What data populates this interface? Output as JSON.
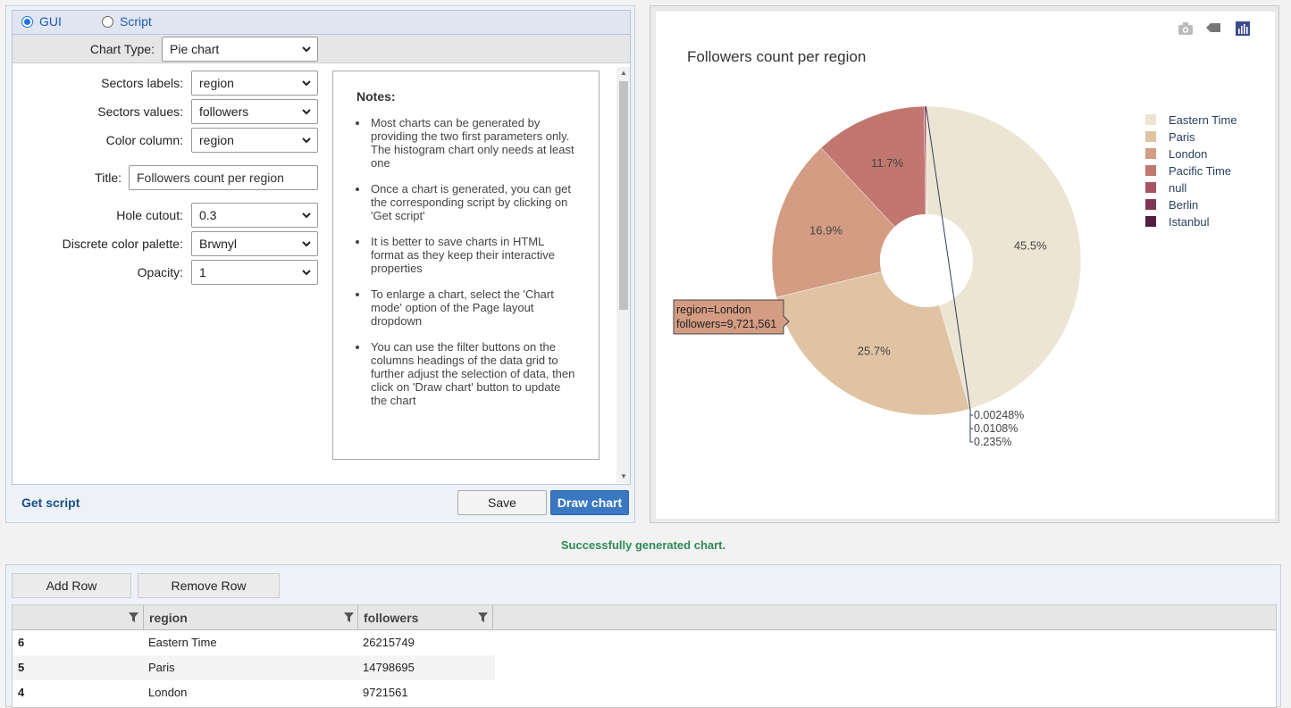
{
  "mode": {
    "options": [
      {
        "label": "GUI",
        "checked": true
      },
      {
        "label": "Script",
        "checked": false
      }
    ]
  },
  "form": {
    "chart_type": {
      "label": "Chart Type:",
      "value": "Pie chart"
    },
    "sectors_labels": {
      "label": "Sectors labels:",
      "value": "region"
    },
    "sectors_values": {
      "label": "Sectors values:",
      "value": "followers"
    },
    "color_column": {
      "label": "Color column:",
      "value": "region"
    },
    "title": {
      "label": "Title:",
      "value": "Followers count per region"
    },
    "hole_cutout": {
      "label": "Hole cutout:",
      "value": "0.3"
    },
    "palette": {
      "label": "Discrete color palette:",
      "value": "Brwnyl"
    },
    "opacity": {
      "label": "Opacity:",
      "value": "1"
    }
  },
  "notes": {
    "title": "Notes:",
    "items": [
      "Most charts can be generated by providing the two first parameters only. The histogram chart only needs at least one",
      "Once a chart is generated, you can get the corresponding script by clicking on 'Get script'",
      "It is better to save charts in HTML format as they keep their interactive properties",
      "To enlarge a chart, select the 'Chart mode' option of the Page layout dropdown",
      "You can use the filter buttons on the columns headings of the data grid to further adjust the selection of data, then click on 'Draw chart' button to update the chart"
    ]
  },
  "actions": {
    "get_script": "Get script",
    "save": "Save",
    "draw_chart": "Draw chart"
  },
  "toolbar_icons": [
    "camera-icon",
    "tag-icon",
    "plotly-logo-icon"
  ],
  "chart_data": {
    "type": "pie",
    "title": "Followers count per region",
    "hole": 0.3,
    "slices": [
      {
        "label": "Eastern Time",
        "value": 26215749,
        "percent_text": "45.5%",
        "color": "#ede5d3"
      },
      {
        "label": "Paris",
        "value": 14798695,
        "percent_text": "25.7%",
        "color": "#e0c3a3"
      },
      {
        "label": "London",
        "value": 9721561,
        "percent_text": "16.9%",
        "color": "#d39c83"
      },
      {
        "label": "Pacific Time",
        "value": 6740000,
        "percent_text": "11.7%",
        "color": "#c1766f"
      },
      {
        "label": "null",
        "value": 135400,
        "percent_text": "0.235%",
        "color": "#a65461"
      },
      {
        "label": "Berlin",
        "value": 6220,
        "percent_text": "0.0108%",
        "color": "#813753"
      },
      {
        "label": "Istanbul",
        "value": 1430,
        "percent_text": "0.00248%",
        "color": "#541f3f"
      }
    ],
    "small_labels_order": [
      "0.00248%",
      "0.0108%",
      "0.235%"
    ],
    "legend_position": "right",
    "tooltip": {
      "line1": "region=London",
      "line2": "followers=9,721,561"
    }
  },
  "status": "Successfully generated chart.",
  "grid": {
    "buttons": {
      "add": "Add Row",
      "remove": "Remove Row"
    },
    "columns": [
      "",
      "region",
      "followers"
    ],
    "rows": [
      {
        "idx": "6",
        "region": "Eastern Time",
        "followers": "26215749"
      },
      {
        "idx": "5",
        "region": "Paris",
        "followers": "14798695"
      },
      {
        "idx": "4",
        "region": "London",
        "followers": "9721561"
      }
    ]
  }
}
